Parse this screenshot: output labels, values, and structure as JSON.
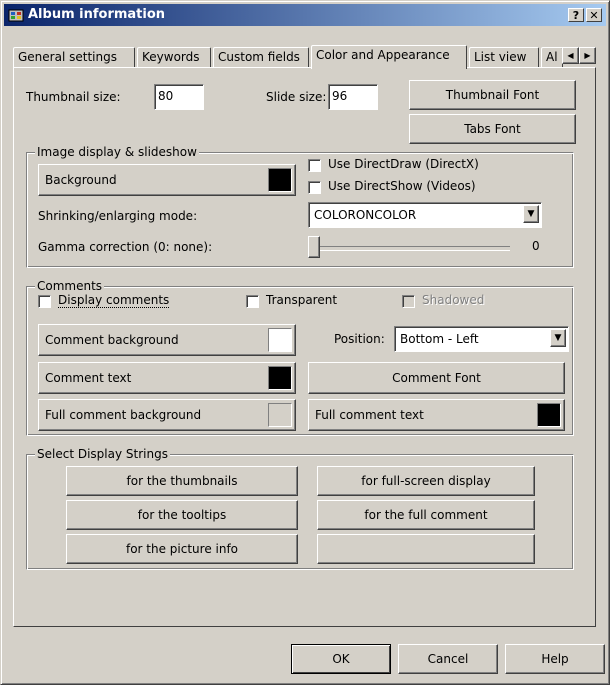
{
  "window": {
    "title": "Album information"
  },
  "title_buttons": {
    "help": "?",
    "close": "✕"
  },
  "tabs": [
    {
      "label": "General settings"
    },
    {
      "label": "Keywords"
    },
    {
      "label": "Custom fields"
    },
    {
      "label": "Color and Appearance"
    },
    {
      "label": "List view"
    },
    {
      "label": "Al"
    }
  ],
  "thumbnail_size": {
    "label": "Thumbnail size:",
    "value": "80"
  },
  "slide_size": {
    "label": "Slide size:",
    "value": "96"
  },
  "buttons": {
    "thumbnail_font": "Thumbnail Font",
    "tabs_font": "Tabs Font",
    "background": "Background",
    "comment_background": "Comment background",
    "comment_text": "Comment text",
    "full_comment_background": "Full comment background",
    "comment_font": "Comment Font",
    "full_comment_text": "Full comment text",
    "ok": "OK",
    "cancel": "Cancel",
    "help": "Help"
  },
  "image_display": {
    "group_label": "Image display & slideshow",
    "use_directdraw": "Use DirectDraw (DirectX)",
    "use_directshow": "Use DirectShow (Videos)",
    "shrinking_label": "Shrinking/enlarging mode:",
    "shrinking_value": "COLORONCOLOR",
    "gamma_label": "Gamma correction (0: none):",
    "gamma_value": "0",
    "gamma_fraction": 0.0
  },
  "comments": {
    "group_label": "Comments",
    "display_comments": "Display comments",
    "transparent": "Transparent",
    "shadowed": "Shadowed",
    "position_label": "Position:",
    "position_value": "Bottom - Left"
  },
  "display_strings": {
    "group_label": "Select Display Strings",
    "for_thumbnails": "for the thumbnails",
    "for_tooltips": "for the tooltips",
    "for_picture_info": "for the picture info",
    "for_full_screen": "for full-screen display",
    "for_full_comment": "for the full comment",
    "empty": ""
  },
  "colors": {
    "background_swatch": "#000000",
    "comment_background_swatch": "#ffffff",
    "comment_text_swatch": "#000000",
    "full_comment_background_swatch": "#d4d0c8",
    "full_comment_text_swatch": "#000000"
  },
  "icons": {
    "app": "album-icon",
    "scroll_left": "triangle-left",
    "scroll_right": "triangle-right",
    "dropdown": "triangle-down"
  }
}
